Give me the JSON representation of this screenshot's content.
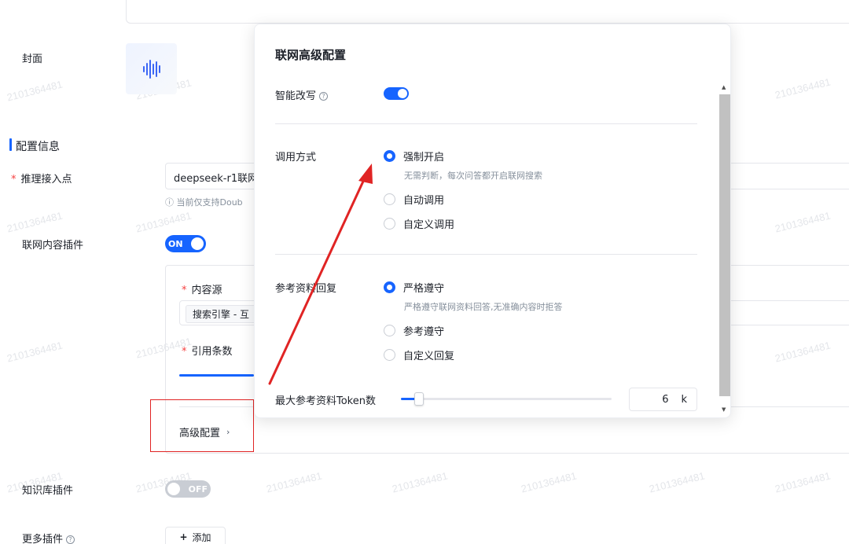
{
  "watermark": "2101364481",
  "form": {
    "cover_label": "封面",
    "section_title": "配置信息",
    "endpoint_label": "推理接入点",
    "endpoint_value": "deepseek-r1联网",
    "endpoint_hint": "ⓘ 当前仅支持Doub",
    "web_plugin_label": "联网内容插件",
    "web_plugin_switch": "ON",
    "content_source_label": "内容源",
    "content_source_tag": "搜索引擎 - 互",
    "citation_count_label": "引用条数",
    "advanced_link": "高级配置",
    "kb_plugin_label": "知识库插件",
    "kb_plugin_switch": "OFF",
    "more_plugins_label": "更多插件",
    "add_button": "添加"
  },
  "popover": {
    "title": "联网高级配置",
    "rewrite_label": "智能改写",
    "call_mode_label": "调用方式",
    "call_mode_options": [
      "强制开启",
      "自动调用",
      "自定义调用"
    ],
    "call_mode_selected_desc": "无需判断，每次问答都开启联网搜索",
    "reply_label": "参考资料回复",
    "reply_options": [
      "严格遵守",
      "参考遵守",
      "自定义回复"
    ],
    "reply_selected_desc": "严格遵守联网资料回答,无准确内容时拒答",
    "max_token_label": "最大参考资料Token数",
    "max_token_value": "6",
    "max_token_unit": "k"
  },
  "colors": {
    "accent": "#1664ff",
    "annotation": "#e02424"
  }
}
